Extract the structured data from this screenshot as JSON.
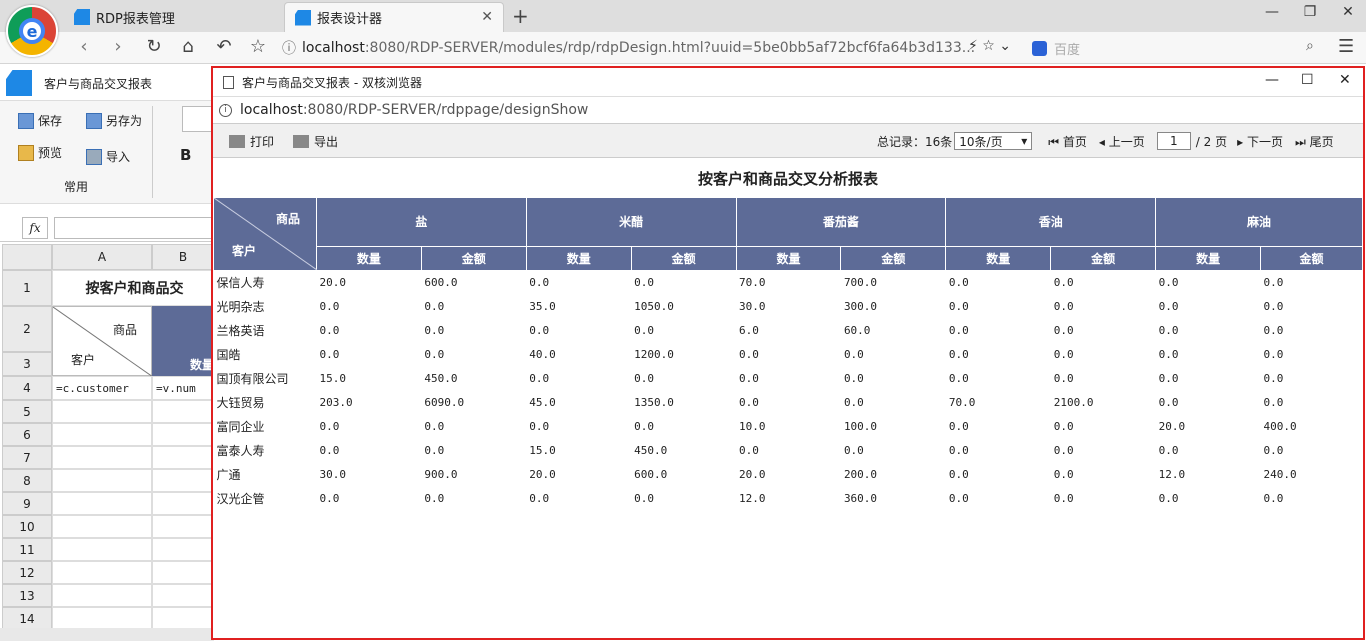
{
  "browser": {
    "tabs": [
      {
        "label": "RDP报表管理"
      },
      {
        "label": "报表设计器"
      }
    ],
    "url_host": "localhost",
    "url_rest": ":8080/RDP-SERVER/modules/rdp/rdpDesign.html?uuid=5be0bb5af72bcf6fa64b3d133...",
    "search_placeholder": "百度"
  },
  "app": {
    "title": "客户与商品交叉报表",
    "ribbon": {
      "save": "保存",
      "save_as": "另存为",
      "preview": "预览",
      "import": "导入",
      "bold": "B",
      "group_label": "常用"
    },
    "formula_label": "fx",
    "columns": [
      "A",
      "B"
    ],
    "rows": [
      "1",
      "2",
      "3",
      "4",
      "5",
      "6",
      "7",
      "8",
      "9",
      "10",
      "11",
      "12",
      "13",
      "14"
    ],
    "cells": {
      "r1_title": "按客户和商品交",
      "r2_goods": "商品",
      "r2_customer": "客户",
      "r3_qty": "数量",
      "r4_a": "=c.customer",
      "r4_b": "=v.num"
    }
  },
  "popup": {
    "window_title": "客户与商品交叉报表 - 双核浏览器",
    "url_host": "localhost",
    "url_rest": ":8080/RDP-SERVER/rdppage/designShow",
    "toolbar": {
      "print": "打印",
      "export": "导出",
      "total": "总记录：16条",
      "page_size": "10条/页",
      "first": "首页",
      "prev": "上一页",
      "page": "1",
      "of_pages": "/ 2 页",
      "next": "下一页",
      "last": "尾页"
    },
    "report": {
      "title": "按客户和商品交叉分析报表",
      "corner_top": "商品",
      "corner_bottom": "客户",
      "products": [
        "盐",
        "米醋",
        "番茄酱",
        "香油",
        "麻油"
      ],
      "sub_headers": [
        "数量",
        "金额"
      ],
      "rows": [
        {
          "customer": "保信人寿",
          "values": [
            "20.0",
            "600.0",
            "0.0",
            "0.0",
            "70.0",
            "700.0",
            "0.0",
            "0.0",
            "0.0",
            "0.0"
          ]
        },
        {
          "customer": "光明杂志",
          "values": [
            "0.0",
            "0.0",
            "35.0",
            "1050.0",
            "30.0",
            "300.0",
            "0.0",
            "0.0",
            "0.0",
            "0.0"
          ]
        },
        {
          "customer": "兰格英语",
          "values": [
            "0.0",
            "0.0",
            "0.0",
            "0.0",
            "6.0",
            "60.0",
            "0.0",
            "0.0",
            "0.0",
            "0.0"
          ]
        },
        {
          "customer": "国皓",
          "values": [
            "0.0",
            "0.0",
            "40.0",
            "1200.0",
            "0.0",
            "0.0",
            "0.0",
            "0.0",
            "0.0",
            "0.0"
          ]
        },
        {
          "customer": "国顶有限公司",
          "values": [
            "15.0",
            "450.0",
            "0.0",
            "0.0",
            "0.0",
            "0.0",
            "0.0",
            "0.0",
            "0.0",
            "0.0"
          ]
        },
        {
          "customer": "大钰贸易",
          "values": [
            "203.0",
            "6090.0",
            "45.0",
            "1350.0",
            "0.0",
            "0.0",
            "70.0",
            "2100.0",
            "0.0",
            "0.0"
          ]
        },
        {
          "customer": "富同企业",
          "values": [
            "0.0",
            "0.0",
            "0.0",
            "0.0",
            "10.0",
            "100.0",
            "0.0",
            "0.0",
            "20.0",
            "400.0"
          ]
        },
        {
          "customer": "富泰人寿",
          "values": [
            "0.0",
            "0.0",
            "15.0",
            "450.0",
            "0.0",
            "0.0",
            "0.0",
            "0.0",
            "0.0",
            "0.0"
          ]
        },
        {
          "customer": "广通",
          "values": [
            "30.0",
            "900.0",
            "20.0",
            "600.0",
            "20.0",
            "200.0",
            "0.0",
            "0.0",
            "12.0",
            "240.0"
          ]
        },
        {
          "customer": "汉光企管",
          "values": [
            "0.0",
            "0.0",
            "0.0",
            "0.0",
            "12.0",
            "360.0",
            "0.0",
            "0.0",
            "0.0",
            "0.0"
          ]
        }
      ]
    }
  },
  "colors": {
    "header_bg": "#5d6b97",
    "popup_border": "#e02020",
    "brand": "#1e88e5"
  }
}
